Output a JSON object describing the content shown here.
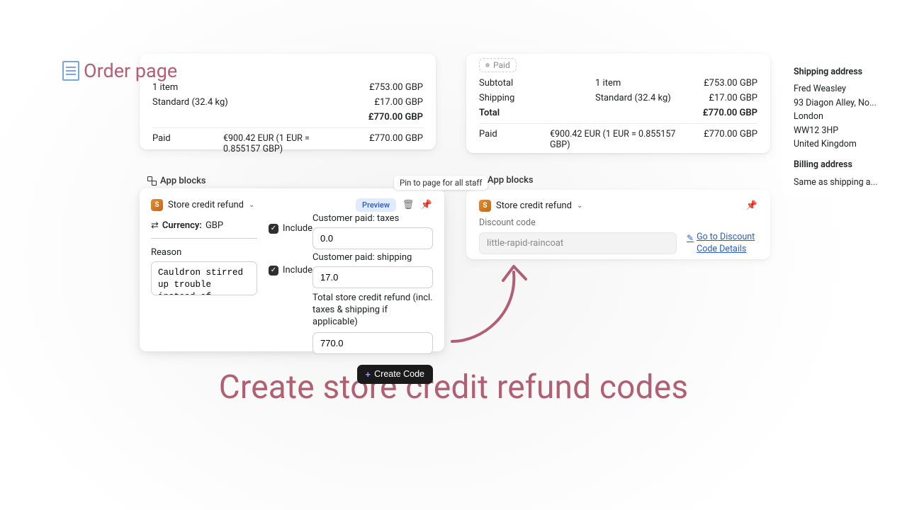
{
  "colors": {
    "accent": "#b16073",
    "link": "#2b5bc7"
  },
  "page": {
    "title": "Order page",
    "big_title": "Create store credit refund codes"
  },
  "left_order": {
    "line1_left": "1 item",
    "line1_right": "£753.00 GBP",
    "line2_left": "Standard (32.4 kg)",
    "line2_right": "£17.00 GBP",
    "total_right": "£770.00 GBP",
    "paid_label": "Paid",
    "paid_mid": "€900.42 EUR (1 EUR = 0.855157 GBP)",
    "paid_right": "£770.00 GBP"
  },
  "right_order": {
    "paid_badge": "Paid",
    "rows": [
      {
        "left": "Subtotal",
        "mid": "1 item",
        "right": "£753.00 GBP"
      },
      {
        "left": "Shipping",
        "mid": "Standard (32.4 kg)",
        "right": "£17.00 GBP"
      },
      {
        "left": "Total",
        "mid": "",
        "right": "£770.00 GBP",
        "bold": true
      }
    ],
    "paid_row": {
      "left": "Paid",
      "mid": "€900.42 EUR (1 EUR = 0.855157 GBP)",
      "right": "£770.00 GBP"
    }
  },
  "address": {
    "ship_h": "Shipping address",
    "name": "Fred Weasley",
    "line1": "93 Diagon Alley, No...",
    "city": "London",
    "post": "WW12 3HP",
    "country": "United Kingdom",
    "bill_h": "Billing address",
    "bill_same": "Same as shipping a..."
  },
  "sections": {
    "app_blocks": "App blocks",
    "pin_tooltip": "Pin to page for all staff"
  },
  "left_app": {
    "title": "Store credit refund",
    "preview": "Preview",
    "currency_label": "Currency:",
    "currency_value": "GBP",
    "reason_label": "Reason",
    "reason_value": "Cauldron stirred up trouble instead of potions.",
    "include": "Include",
    "taxes_label": "Customer paid: taxes",
    "taxes_value": "0.0",
    "ship_label": "Customer paid: shipping",
    "ship_value": "17.0",
    "total_label": "Total store credit refund (incl. taxes & shipping if applicable)",
    "total_value": "770.0",
    "create_btn": "Create Code"
  },
  "right_app": {
    "title": "Store credit refund",
    "discount_label": "Discount code",
    "code": "little-rapid-raincoat",
    "link": "Go to Discount Code Details"
  }
}
